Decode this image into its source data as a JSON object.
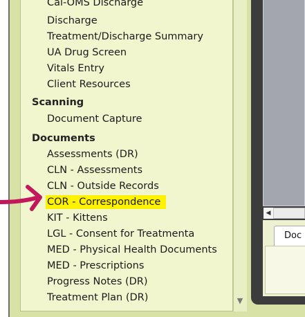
{
  "nav": {
    "clinical_items": [
      "Cal-OMS Discharge",
      "Discharge",
      "Treatment/Discharge Summary",
      "UA Drug Screen",
      "Vitals Entry",
      "Client Resources"
    ],
    "scanning": {
      "heading": "Scanning",
      "items": [
        "Document Capture"
      ]
    },
    "documents": {
      "heading": "Documents",
      "items": [
        "Assessments (DR)",
        "CLN - Assessments",
        "CLN - Outside Records",
        "COR - Correspondence",
        "KIT - Kittens",
        "LGL - Consent for Treatmenta",
        "MED - Physical Health Documents",
        "MED - Prescriptions",
        "Progress Notes (DR)",
        "Treatment Plan (DR)"
      ]
    }
  },
  "right_panel": {
    "tab_label": "Doc"
  },
  "colors": {
    "panel_green": "#d8e2a6",
    "list_bg": "#f2f6cf",
    "highlight": "#fff200",
    "arrow": "#c2185b"
  },
  "icons": {
    "scroll_down": "triangle-down-icon",
    "scroll_left": "triangle-left-icon",
    "annotation_arrow": "right-arrow-icon"
  }
}
